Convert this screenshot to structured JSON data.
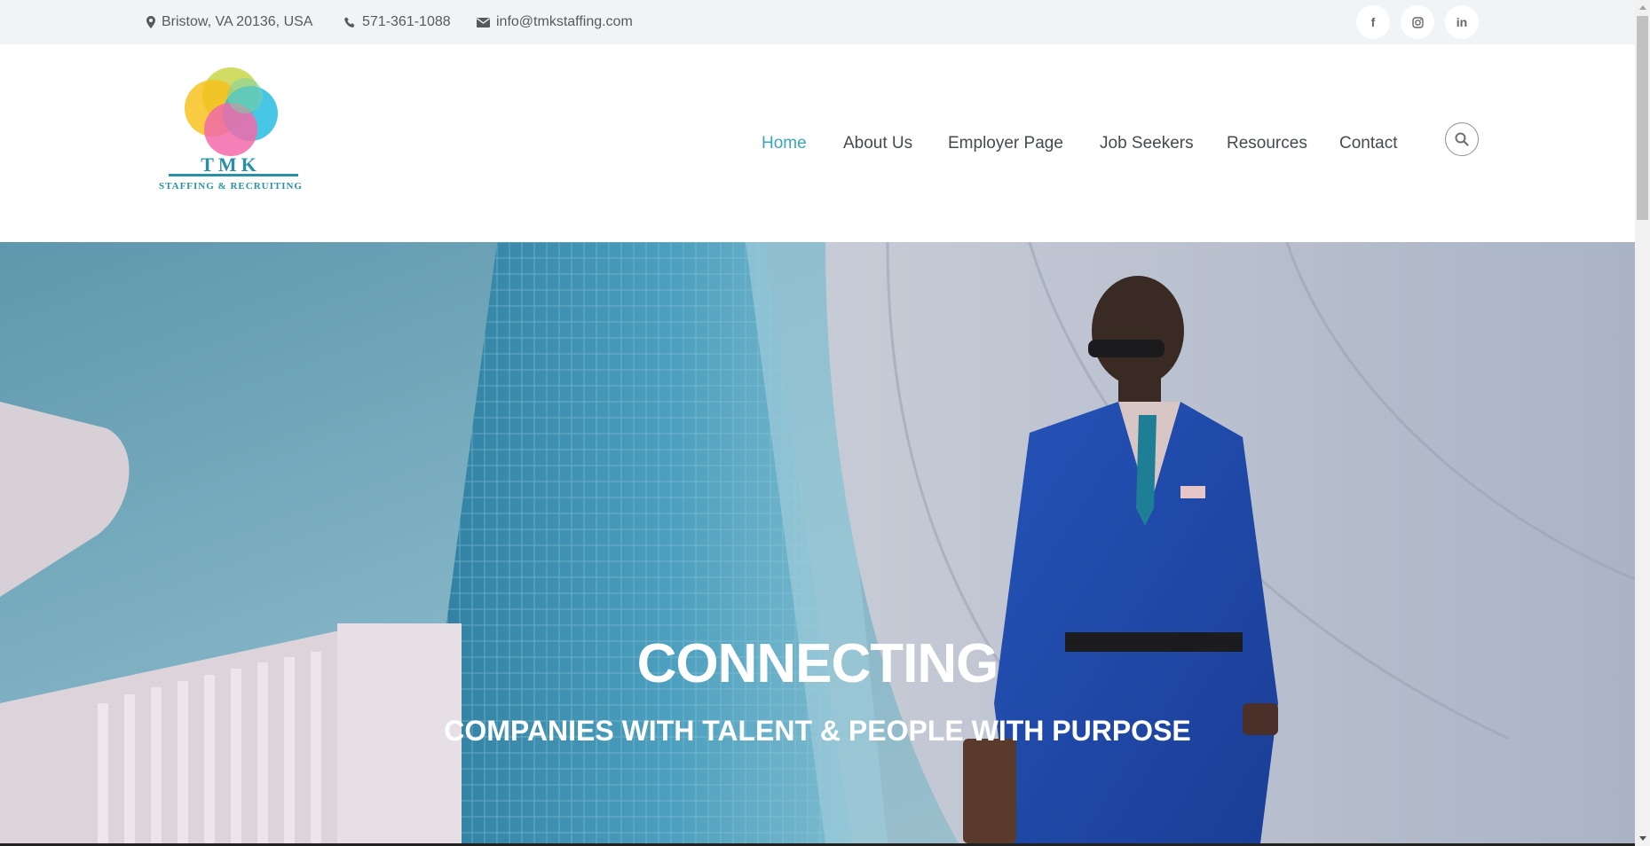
{
  "topbar": {
    "address": "Bristow, VA 20136, USA",
    "phone": "571-361-1088",
    "email": "info@tmkstaffing.com",
    "social": [
      {
        "icon": "facebook-icon",
        "glyph": "f"
      },
      {
        "icon": "instagram-icon",
        "glyph": ""
      },
      {
        "icon": "linkedin-icon",
        "glyph": "in"
      }
    ]
  },
  "logo": {
    "name": "TMK",
    "tagline": "STAFFING & RECRUITING"
  },
  "nav": {
    "items": [
      {
        "label": "Home",
        "active": true
      },
      {
        "label": "About Us",
        "active": false
      },
      {
        "label": "Employer Page",
        "active": false
      },
      {
        "label": "Job Seekers",
        "active": false
      },
      {
        "label": "Resources",
        "active": false
      },
      {
        "label": "Contact",
        "active": false
      }
    ]
  },
  "hero": {
    "title": "CONNECTING",
    "subtitle": "COMPANIES WITH TALENT & PEOPLE WITH PURPOSE"
  },
  "colors": {
    "accent": "#3aa7b8",
    "text": "#444a4f",
    "topbar_bg": "#f1f4f6",
    "logo_teal": "#2a90a8"
  }
}
